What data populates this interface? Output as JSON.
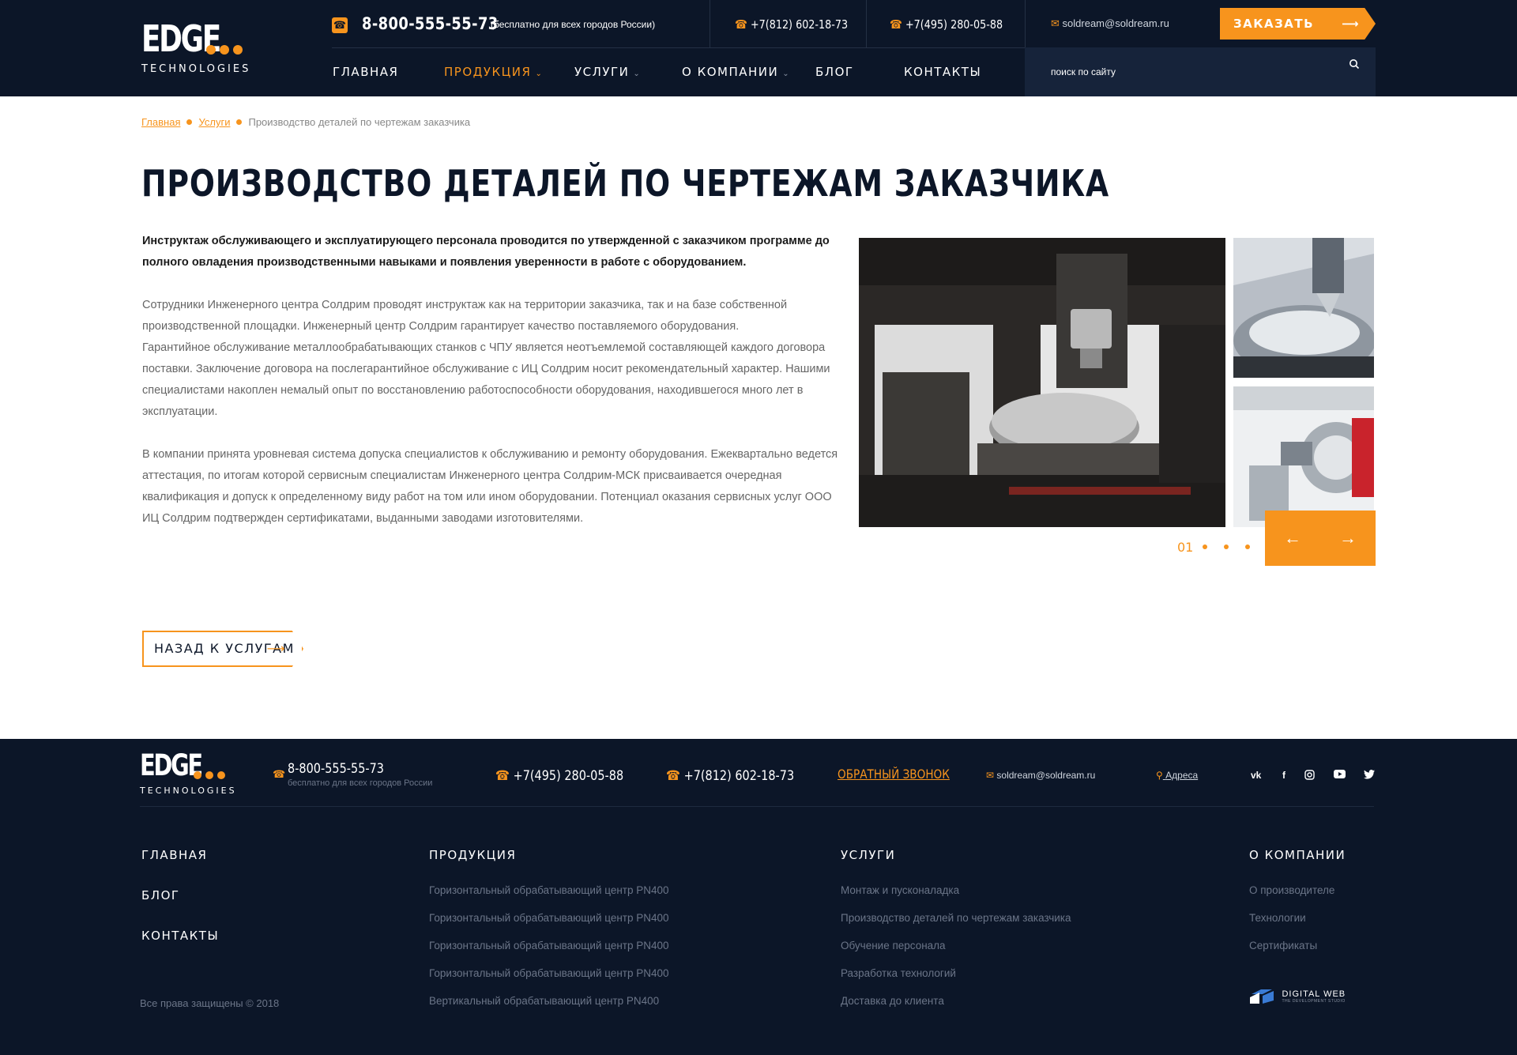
{
  "header": {
    "logo_word": "EDGE",
    "logo_sub": "TECHNOLOGIES",
    "phone_main": "8-800-555-55-73",
    "phone_note": "(бесплатно для всех городов России)",
    "phone_spb": "+7(812) 602-18-73",
    "phone_msk": "+7(495) 280-05-88",
    "email": "soldream@soldream.ru",
    "call_button": "ЗАКАЗАТЬ ЗВОНОК",
    "search_placeholder": "поиск по сайту",
    "nav": [
      {
        "label": "ГЛАВНАЯ"
      },
      {
        "label": "ПРОДУКЦИЯ"
      },
      {
        "label": "УСЛУГИ"
      },
      {
        "label": "О КОМПАНИИ"
      },
      {
        "label": "БЛОГ"
      },
      {
        "label": "КОНТАКТЫ"
      }
    ]
  },
  "breadcrumb": {
    "home": "Главная",
    "services": "Услуги",
    "current": "Производство деталей по чертежам заказчика"
  },
  "page": {
    "title": "ПРОИЗВОДСТВО ДЕТАЛЕЙ ПО ЧЕРТЕЖАМ ЗАКАЗЧИКА",
    "lead": "Инструктаж обслуживающего и эксплуатирующего персонала проводится по утвержденной с заказчиком программе до полного овладения производственными навыками и появления уверенности в работе с оборудованием.",
    "p1": "Сотрудники Инженерного центра Солдрим проводят инструктаж как на территории заказчика, так и на базе собственной производственной площадки. Инженерный центр Солдрим гарантирует качество поставляемого оборудования.",
    "p2": "Гарантийное обслуживание металлообрабатывающих станков с ЧПУ является неотъемлемой составляющей каждого договора поставки. Заключение договора на послегарантийное обслуживание с ИЦ Солдрим носит рекомендательный характер. Нашими специалистами накоплен немалый опыт по восстановлению работоспособности оборудования, находившегося много лет в эксплуатации.",
    "p3": "В компании принята уровневая система допуска специалистов к обслуживанию и ремонту оборудования. Ежеквартально ведется аттестация, по итогам которой сервисным специалистам Инженерного центра Солдрим-МСК присваивается очередная квалификация и допуск к определенному  виду работ на том или ином оборудовании. Потенциал оказания сервисных услуг ООО ИЦ Солдрим подтвержден сертификатами, выданными заводами изготовителями.",
    "back_button": "НАЗАД К УСЛУГАМ"
  },
  "gallery": {
    "counter": "01",
    "accent": "#f7941d"
  },
  "footer": {
    "phone_main": "8-800-555-55-73",
    "phone_note": "бесплатно для всех городов России",
    "phone_msk": "+7(495) 280-05-88",
    "phone_spb": "+7(812) 602-18-73",
    "callback": "ОБРАТНЫЙ ЗВОНОК",
    "email": "soldream@soldream.ru",
    "address": "Адреса",
    "main_links": [
      "ГЛАВНАЯ",
      "БЛОГ",
      "КОНТАКТЫ"
    ],
    "products_title": "ПРОДУКЦИЯ",
    "products": [
      "Горизонтальный обрабатывающий центр PN400",
      "Горизонтальный обрабатывающий центр PN400",
      "Горизонтальный обрабатывающий центр PN400",
      "Горизонтальный обрабатывающий центр PN400",
      "Вертикальный обрабатывающий центр PN400"
    ],
    "services_title": "УСЛУГИ",
    "services": [
      "Монтаж и пусконаладка",
      "Производство деталей по чертежам заказчика",
      "Обучение персонала",
      "Разработка технологий",
      "Доставка до клиента"
    ],
    "about_title": "О КОМПАНИИ",
    "about": [
      "О производителе",
      "Технологии",
      "Сертификаты"
    ],
    "copyright": "Все права защищены © 2018",
    "dev_name": "DIGITAL WEB",
    "dev_sub": "THE DEVELOPMENT STUDIO"
  },
  "colors": {
    "dark": "#0c1628",
    "accent": "#f7941d"
  }
}
